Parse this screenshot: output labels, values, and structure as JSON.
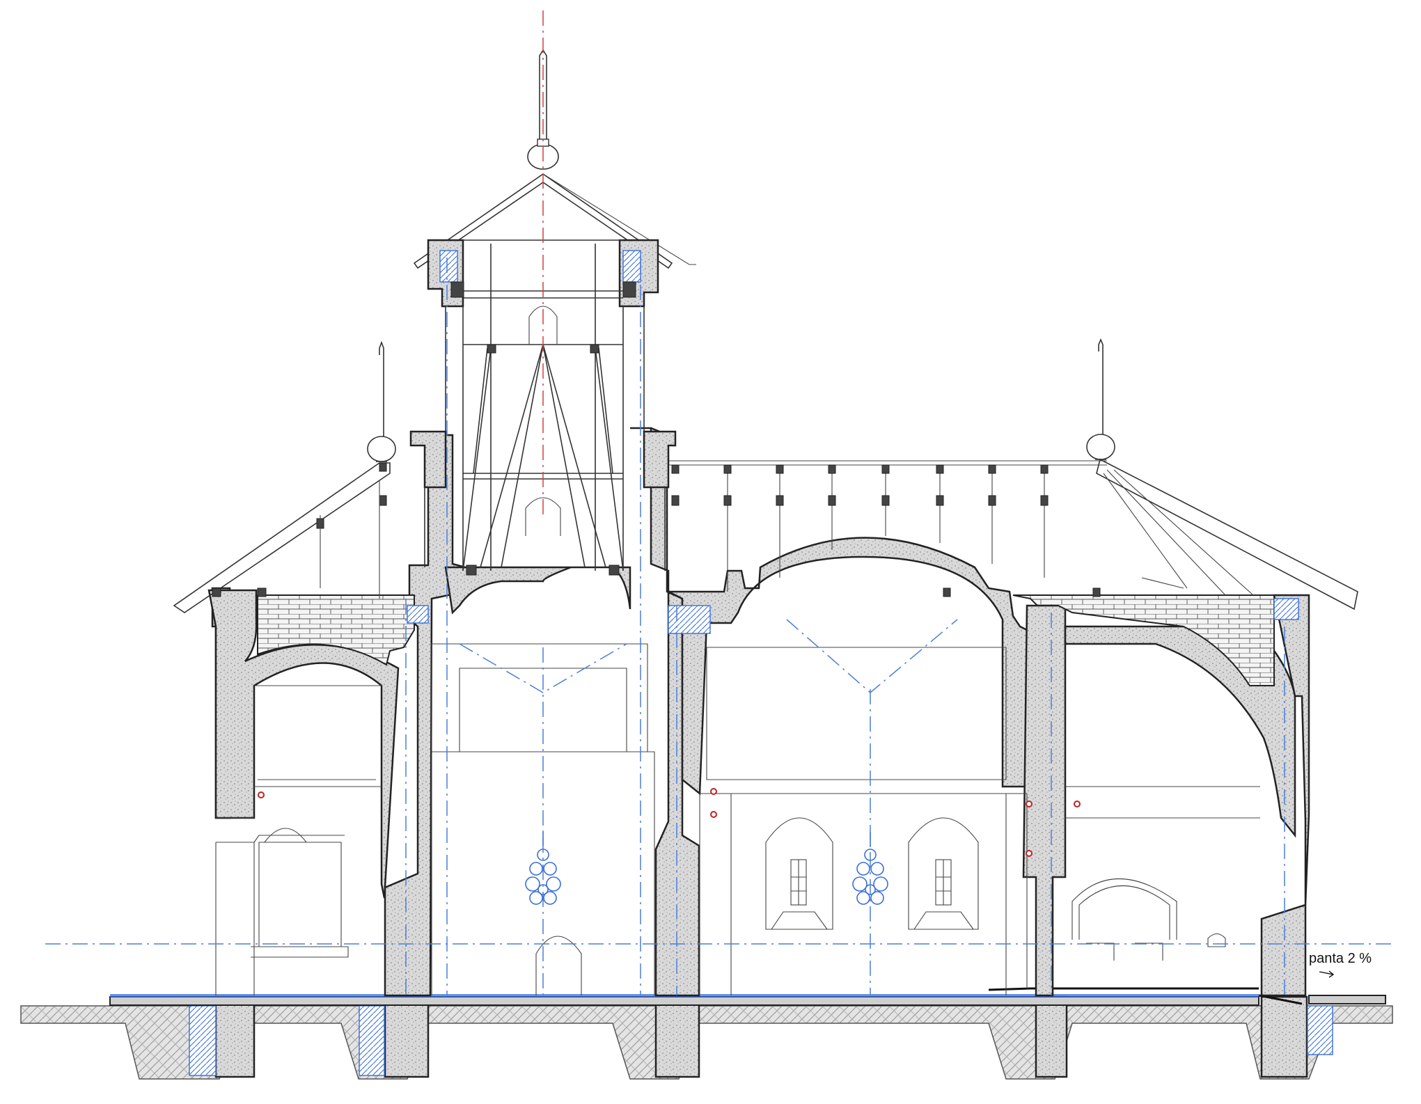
{
  "annotations": {
    "slope_label": "panta 2 %"
  },
  "colors": {
    "axis": "#4a7ed8",
    "axis_center": "#d04040",
    "wall_outline": "#222222",
    "insulation": "#3a6fd8",
    "marker": "#c02020"
  },
  "icons": {
    "chandelier": "chandelier-icon",
    "slope_arrow": "slope-arrow-icon",
    "marker": "red-circle-marker-icon"
  }
}
